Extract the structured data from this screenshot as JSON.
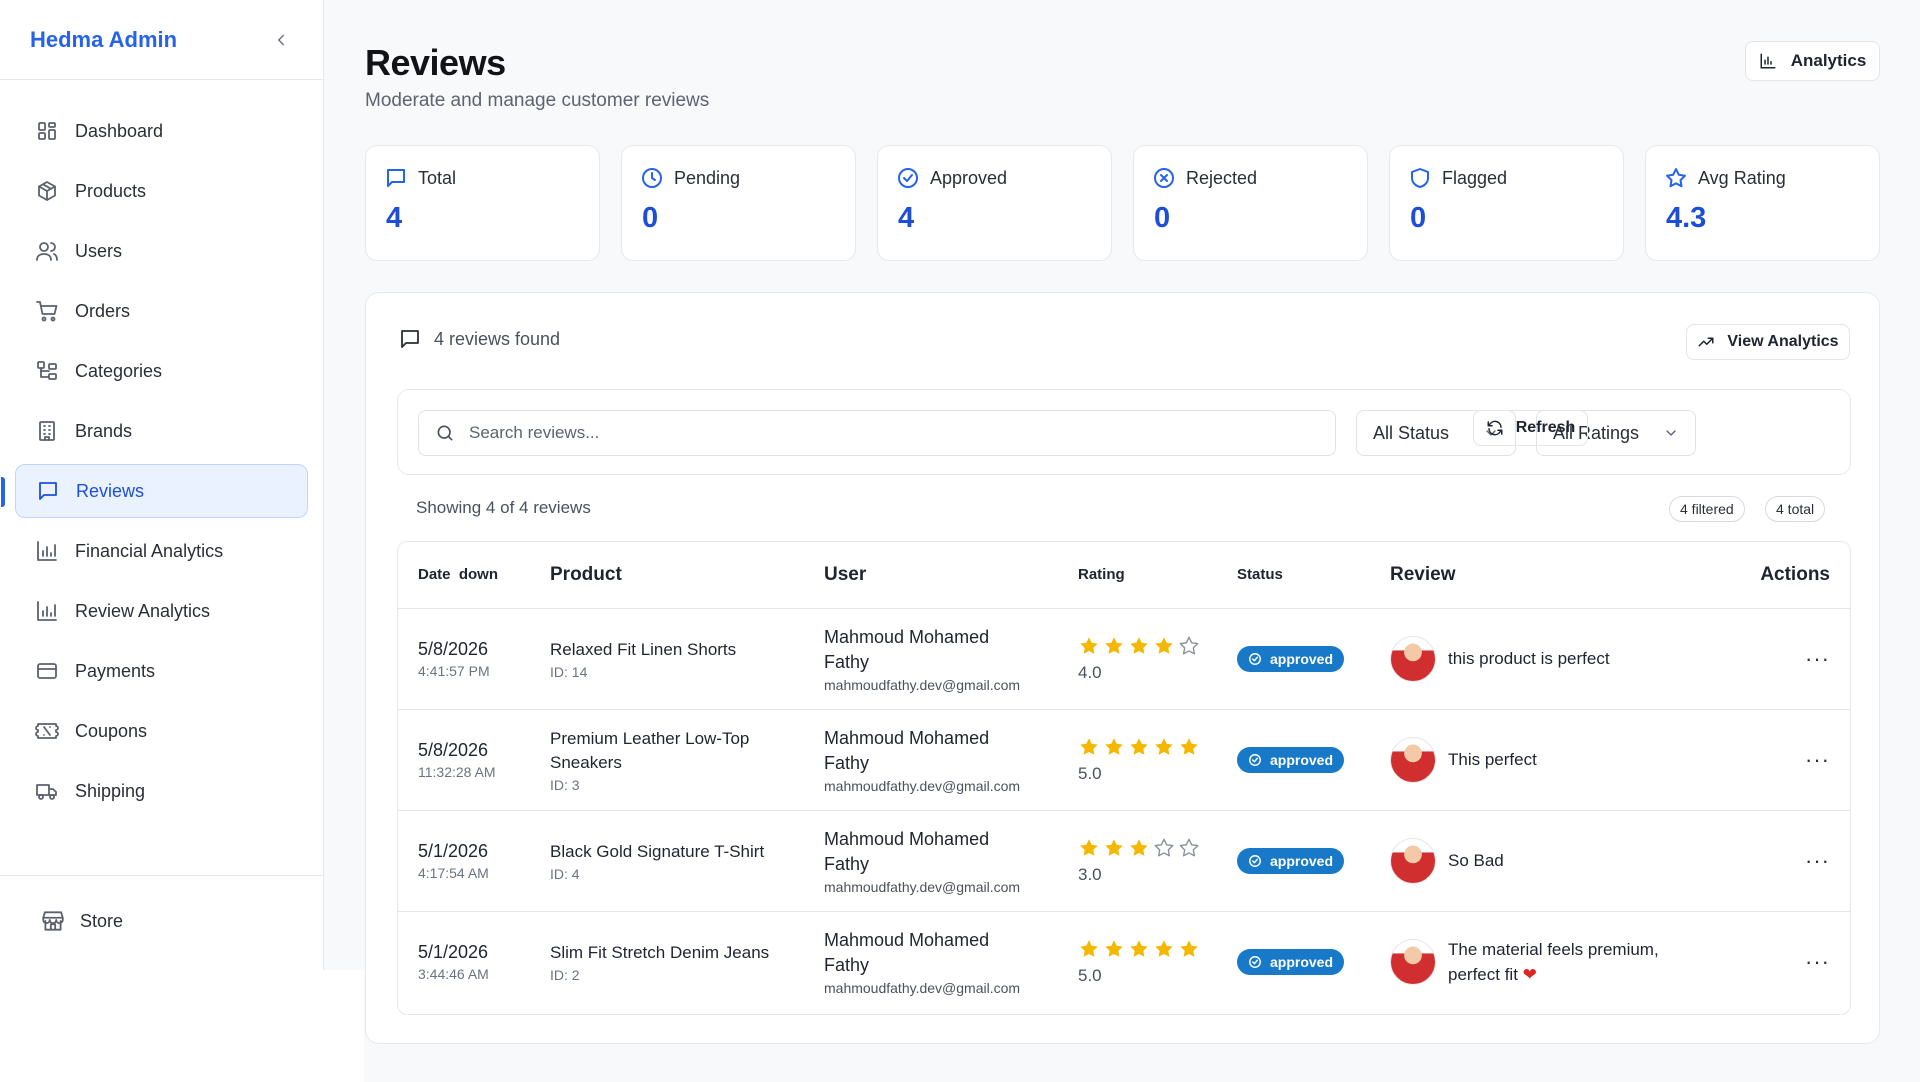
{
  "sidebar": {
    "brand": "Hedma Admin",
    "items": [
      {
        "label": "Dashboard",
        "icon": "grid-icon"
      },
      {
        "label": "Products",
        "icon": "package-icon"
      },
      {
        "label": "Users",
        "icon": "users-icon"
      },
      {
        "label": "Orders",
        "icon": "cart-icon"
      },
      {
        "label": "Categories",
        "icon": "tree-icon"
      },
      {
        "label": "Brands",
        "icon": "building-icon"
      },
      {
        "label": "Reviews",
        "icon": "message-icon",
        "active": true
      },
      {
        "label": "Financial Analytics",
        "icon": "bar-chart-icon"
      },
      {
        "label": "Review Analytics",
        "icon": "bar-chart-icon"
      },
      {
        "label": "Payments",
        "icon": "credit-card-icon"
      },
      {
        "label": "Coupons",
        "icon": "ticket-icon"
      },
      {
        "label": "Shipping",
        "icon": "truck-icon"
      }
    ],
    "store_label": "Store"
  },
  "header": {
    "title": "Reviews",
    "subtitle": "Moderate and manage customer reviews",
    "analytics_button": "Analytics"
  },
  "stats": [
    {
      "label": "Total",
      "value": "4",
      "icon": "message-icon"
    },
    {
      "label": "Pending",
      "value": "0",
      "icon": "clock-icon"
    },
    {
      "label": "Approved",
      "value": "4",
      "icon": "check-circle-icon"
    },
    {
      "label": "Rejected",
      "value": "0",
      "icon": "x-circle-icon"
    },
    {
      "label": "Flagged",
      "value": "0",
      "icon": "shield-icon"
    },
    {
      "label": "Avg Rating",
      "value": "4.3",
      "icon": "star-icon"
    }
  ],
  "panel": {
    "found_text": "4 reviews found",
    "view_analytics": "View Analytics",
    "search_placeholder": "Search reviews...",
    "status_select": "All Status",
    "ratings_select": "All Ratings",
    "refresh": "Refresh",
    "showing": "Showing 4 of 4 reviews",
    "filtered_pill": "4 filtered",
    "total_pill": "4 total"
  },
  "table": {
    "headers": {
      "date": "Date",
      "date_sort": "down",
      "product": "Product",
      "user": "User",
      "rating": "Rating",
      "status": "Status",
      "review": "Review",
      "actions": "Actions"
    },
    "rows": [
      {
        "date": "5/8/2026",
        "time": "4:41:57 PM",
        "product": "Relaxed Fit Linen Shorts",
        "product_id": "ID: 14",
        "user_name": "Mahmoud Mohamed Fathy",
        "user_email": "mahmoudfathy.dev@gmail.com",
        "rating": 4,
        "rating_text": "4.0",
        "status": "approved",
        "review": "this product is perfect",
        "has_heart": false
      },
      {
        "date": "5/8/2026",
        "time": "11:32:28 AM",
        "product": "Premium Leather Low-Top Sneakers",
        "product_id": "ID: 3",
        "user_name": "Mahmoud Mohamed Fathy",
        "user_email": "mahmoudfathy.dev@gmail.com",
        "rating": 5,
        "rating_text": "5.0",
        "status": "approved",
        "review": "This perfect",
        "has_heart": false
      },
      {
        "date": "5/1/2026",
        "time": "4:17:54 AM",
        "product": "Black Gold Signature T-Shirt",
        "product_id": "ID: 4",
        "user_name": "Mahmoud Mohamed Fathy",
        "user_email": "mahmoudfathy.dev@gmail.com",
        "rating": 3,
        "rating_text": "3.0",
        "status": "approved",
        "review": "So Bad",
        "has_heart": false
      },
      {
        "date": "5/1/2026",
        "time": "3:44:46 AM",
        "product": "Slim Fit Stretch Denim Jeans",
        "product_id": "ID: 2",
        "user_name": "Mahmoud Mohamed Fathy",
        "user_email": "mahmoudfathy.dev@gmail.com",
        "rating": 5,
        "rating_text": "5.0",
        "status": "approved",
        "review": "The material feels premium, perfect fit",
        "has_heart": true
      }
    ],
    "actions_glyph": "···"
  },
  "colors": {
    "accent": "#2563eb",
    "badge": "#1779c7",
    "star": "#f5b800",
    "heart": "#dc2626"
  }
}
